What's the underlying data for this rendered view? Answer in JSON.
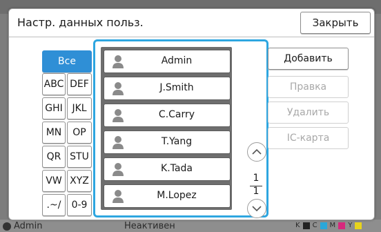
{
  "dialog": {
    "title": "Настр. данных польз.",
    "close_label": "Закрыть"
  },
  "filters": [
    {
      "label": "Все",
      "selected": true
    },
    {
      "label": "ABC"
    },
    {
      "label": "DEF"
    },
    {
      "label": "GHI"
    },
    {
      "label": "JKL"
    },
    {
      "label": "MN"
    },
    {
      "label": "OP"
    },
    {
      "label": "QR"
    },
    {
      "label": "STU"
    },
    {
      "label": "VW"
    },
    {
      "label": "XYZ"
    },
    {
      "label": ".~/"
    },
    {
      "label": "0-9"
    }
  ],
  "users": [
    {
      "name": "Admin"
    },
    {
      "name": "J.Smith"
    },
    {
      "name": "C.Carry"
    },
    {
      "name": "T.Yang"
    },
    {
      "name": "K.Tada"
    },
    {
      "name": "M.Lopez"
    }
  ],
  "pagination": {
    "current": "1",
    "total": "1"
  },
  "actions": {
    "add": "Добавить",
    "edit": "Правка",
    "delete": "Удалить",
    "ic_card": "IC-карта"
  },
  "status_bar": {
    "user": "Admin",
    "state": "Неактивен",
    "inks": [
      "K",
      "C",
      "M",
      "Y"
    ]
  },
  "colors": {
    "accent": "#2ea6e0",
    "selected_filter": "#2f8fd6"
  }
}
